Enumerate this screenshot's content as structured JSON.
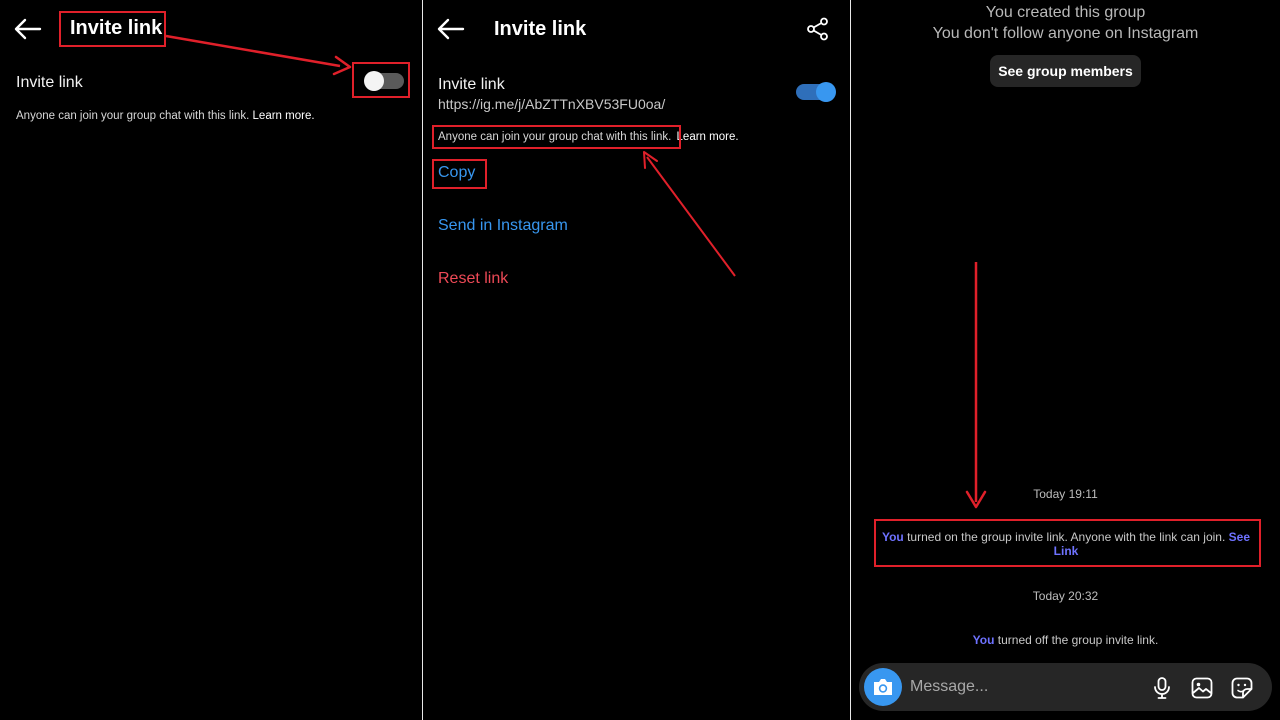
{
  "panel1": {
    "title": "Invite link",
    "row_label": "Invite link",
    "toggle_state": "off",
    "description": "Anyone can join your group chat with this link.",
    "learn_more": "Learn more."
  },
  "panel2": {
    "title": "Invite link",
    "row_label": "Invite link",
    "url": "https://ig.me/j/AbZTTnXBV53FU0oa/",
    "toggle_state": "on",
    "description": "Anyone can join your group chat with this link.",
    "learn_more": "Learn more.",
    "copy": "Copy",
    "send": "Send in Instagram",
    "reset": "Reset link"
  },
  "panel3": {
    "created": "You created this group",
    "follow": "You don't follow anyone on Instagram",
    "see_members": "See group members",
    "time1": "Today 19:11",
    "notice1_you": "You",
    "notice1_text": " turned on the group invite link. Anyone with the link can join. ",
    "notice1_see": "See",
    "notice1_link": "Link",
    "time2": "Today 20:32",
    "notice2_you": "You",
    "notice2_text": " turned off the group invite link.",
    "message_placeholder": "Message..."
  },
  "colors": {
    "annotation_red": "#e0202a",
    "instagram_blue": "#3897f0",
    "reset_red": "#ed4956",
    "mention_purple": "#6e72ff"
  }
}
